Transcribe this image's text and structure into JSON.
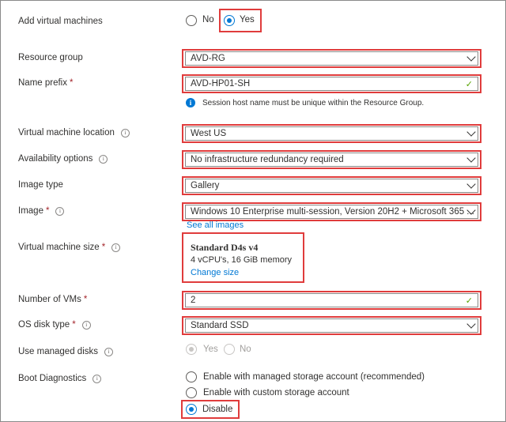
{
  "add_vms": {
    "label": "Add virtual machines",
    "options": [
      "No",
      "Yes"
    ],
    "selected": "Yes"
  },
  "resource_group": {
    "label": "Resource group",
    "value": "AVD-RG"
  },
  "name_prefix": {
    "label": "Name prefix",
    "value": "AVD-HP01-SH",
    "note": "Session host name must be unique within the Resource Group."
  },
  "vm_location": {
    "label": "Virtual machine location",
    "value": "West US"
  },
  "availability": {
    "label": "Availability options",
    "value": "No infrastructure redundancy required"
  },
  "image_type": {
    "label": "Image type",
    "value": "Gallery"
  },
  "image": {
    "label": "Image",
    "value": "Windows 10 Enterprise multi-session, Version 20H2 + Microsoft 365 ...",
    "see_all": "See all images"
  },
  "vm_size": {
    "label": "Virtual machine size",
    "name": "Standard D4s v4",
    "spec": "4 vCPU's, 16 GiB memory",
    "change": "Change size"
  },
  "num_vms": {
    "label": "Number of VMs",
    "value": "2"
  },
  "os_disk": {
    "label": "OS disk type",
    "value": "Standard SSD"
  },
  "managed_disks": {
    "label": "Use managed disks",
    "options": [
      "Yes",
      "No"
    ],
    "selected": "Yes"
  },
  "boot_diag": {
    "label": "Boot Diagnostics",
    "options": [
      "Enable with managed storage account (recommended)",
      "Enable with custom storage account",
      "Disable"
    ],
    "selected": "Disable"
  },
  "glyphs": {
    "required": "*",
    "info": "i",
    "check": "✓",
    "note_icon": "i"
  },
  "colors": {
    "highlight": "#e03c3c",
    "accent": "#0078d4",
    "valid": "#57a300",
    "required": "#a4262c"
  }
}
